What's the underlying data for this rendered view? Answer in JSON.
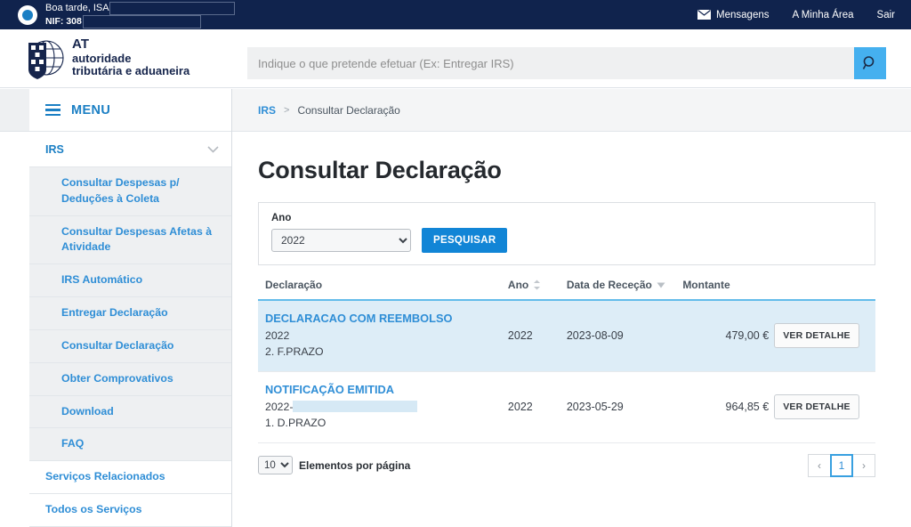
{
  "topbar": {
    "greeting": "Boa tarde, ISA",
    "nif_label": "NIF: 308",
    "messages_label": "Mensagens",
    "my_area_label": "A Minha Área",
    "logout_label": "Sair"
  },
  "brand": {
    "line1": "AT",
    "line2": "autoridade",
    "line3": "tributária e aduaneira"
  },
  "search": {
    "placeholder": "Indique o que pretende efetuar (Ex: Entregar IRS)",
    "value": ""
  },
  "sidebar": {
    "menu_label": "MENU",
    "section_label": "IRS",
    "items": [
      {
        "label": "Consultar Despesas p/ Deduções à Coleta"
      },
      {
        "label": "Consultar Despesas Afetas à Atividade"
      },
      {
        "label": "IRS Automático"
      },
      {
        "label": "Entregar Declaração"
      },
      {
        "label": "Consultar Declaração"
      },
      {
        "label": "Obter Comprovativos"
      },
      {
        "label": "Download"
      },
      {
        "label": "FAQ"
      }
    ],
    "footer_items": [
      {
        "label": "Serviços Relacionados"
      },
      {
        "label": "Todos os Serviços"
      }
    ]
  },
  "breadcrumb": {
    "root": "IRS",
    "separator": ">",
    "current": "Consultar Declaração"
  },
  "main": {
    "title": "Consultar Declaração",
    "filter": {
      "year_label": "Ano",
      "year_value": "2022",
      "year_options": [
        "2022"
      ],
      "search_button": "PESQUISAR"
    },
    "table": {
      "headers": {
        "declaracao": "Declaração",
        "ano": "Ano",
        "data": "Data de Receção",
        "montante": "Montante",
        "acao": ""
      },
      "rows": [
        {
          "title": "DECLARACAO COM REEMBOLSO",
          "line2": "2022",
          "line3": "2. F.PRAZO",
          "ano": "2022",
          "data": "2023-08-09",
          "montante": "479,00 €",
          "action": "VER DETALHE"
        },
        {
          "title": "NOTIFICAÇÃO EMITIDA",
          "line2": "2022-",
          "line3": "1. D.PRAZO",
          "ano": "2022",
          "data": "2023-05-29",
          "montante": "964,85 €",
          "action": "VER DETALHE"
        }
      ]
    },
    "pagination": {
      "per_page_value": "10",
      "per_page_options": [
        "10"
      ],
      "per_page_label": "Elementos por página",
      "prev": "‹",
      "current_page": "1",
      "next": "›"
    }
  },
  "colors": {
    "topbar_bg": "#10234d",
    "brand_navy": "#16254c",
    "link_blue": "#2f8ed6",
    "accent_blue": "#1185d6",
    "search_btn": "#45b0ef",
    "row_highlight": "#ddedf7",
    "table_rule": "#63bcea"
  }
}
